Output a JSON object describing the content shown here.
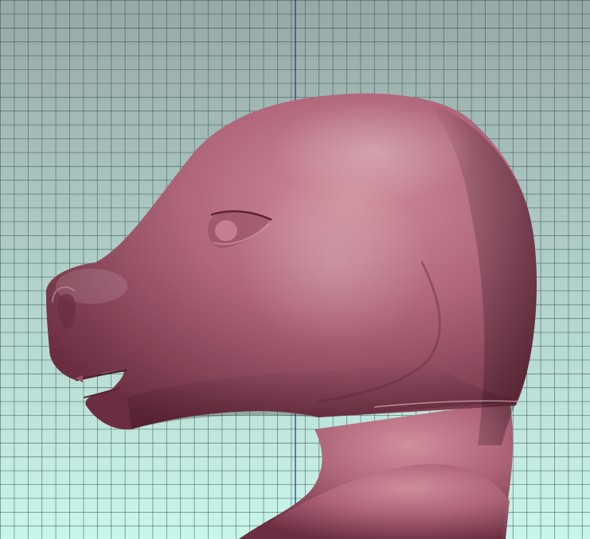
{
  "viewport": {
    "kind": "3d-sculpt-viewport",
    "view": "side",
    "background": {
      "top_color": "#97a8a6",
      "bottom_color": "#c9f6eb",
      "grid_color": "#2f4a48",
      "vertical_axis_color": "#2b2d86",
      "grid_visible": true
    },
    "model": {
      "subject": "animal-head-and-neck",
      "base_color": "#b0667b",
      "highlight_color": "#d08f9c",
      "shadow_color": "#6b2e40",
      "facing": "left"
    }
  }
}
